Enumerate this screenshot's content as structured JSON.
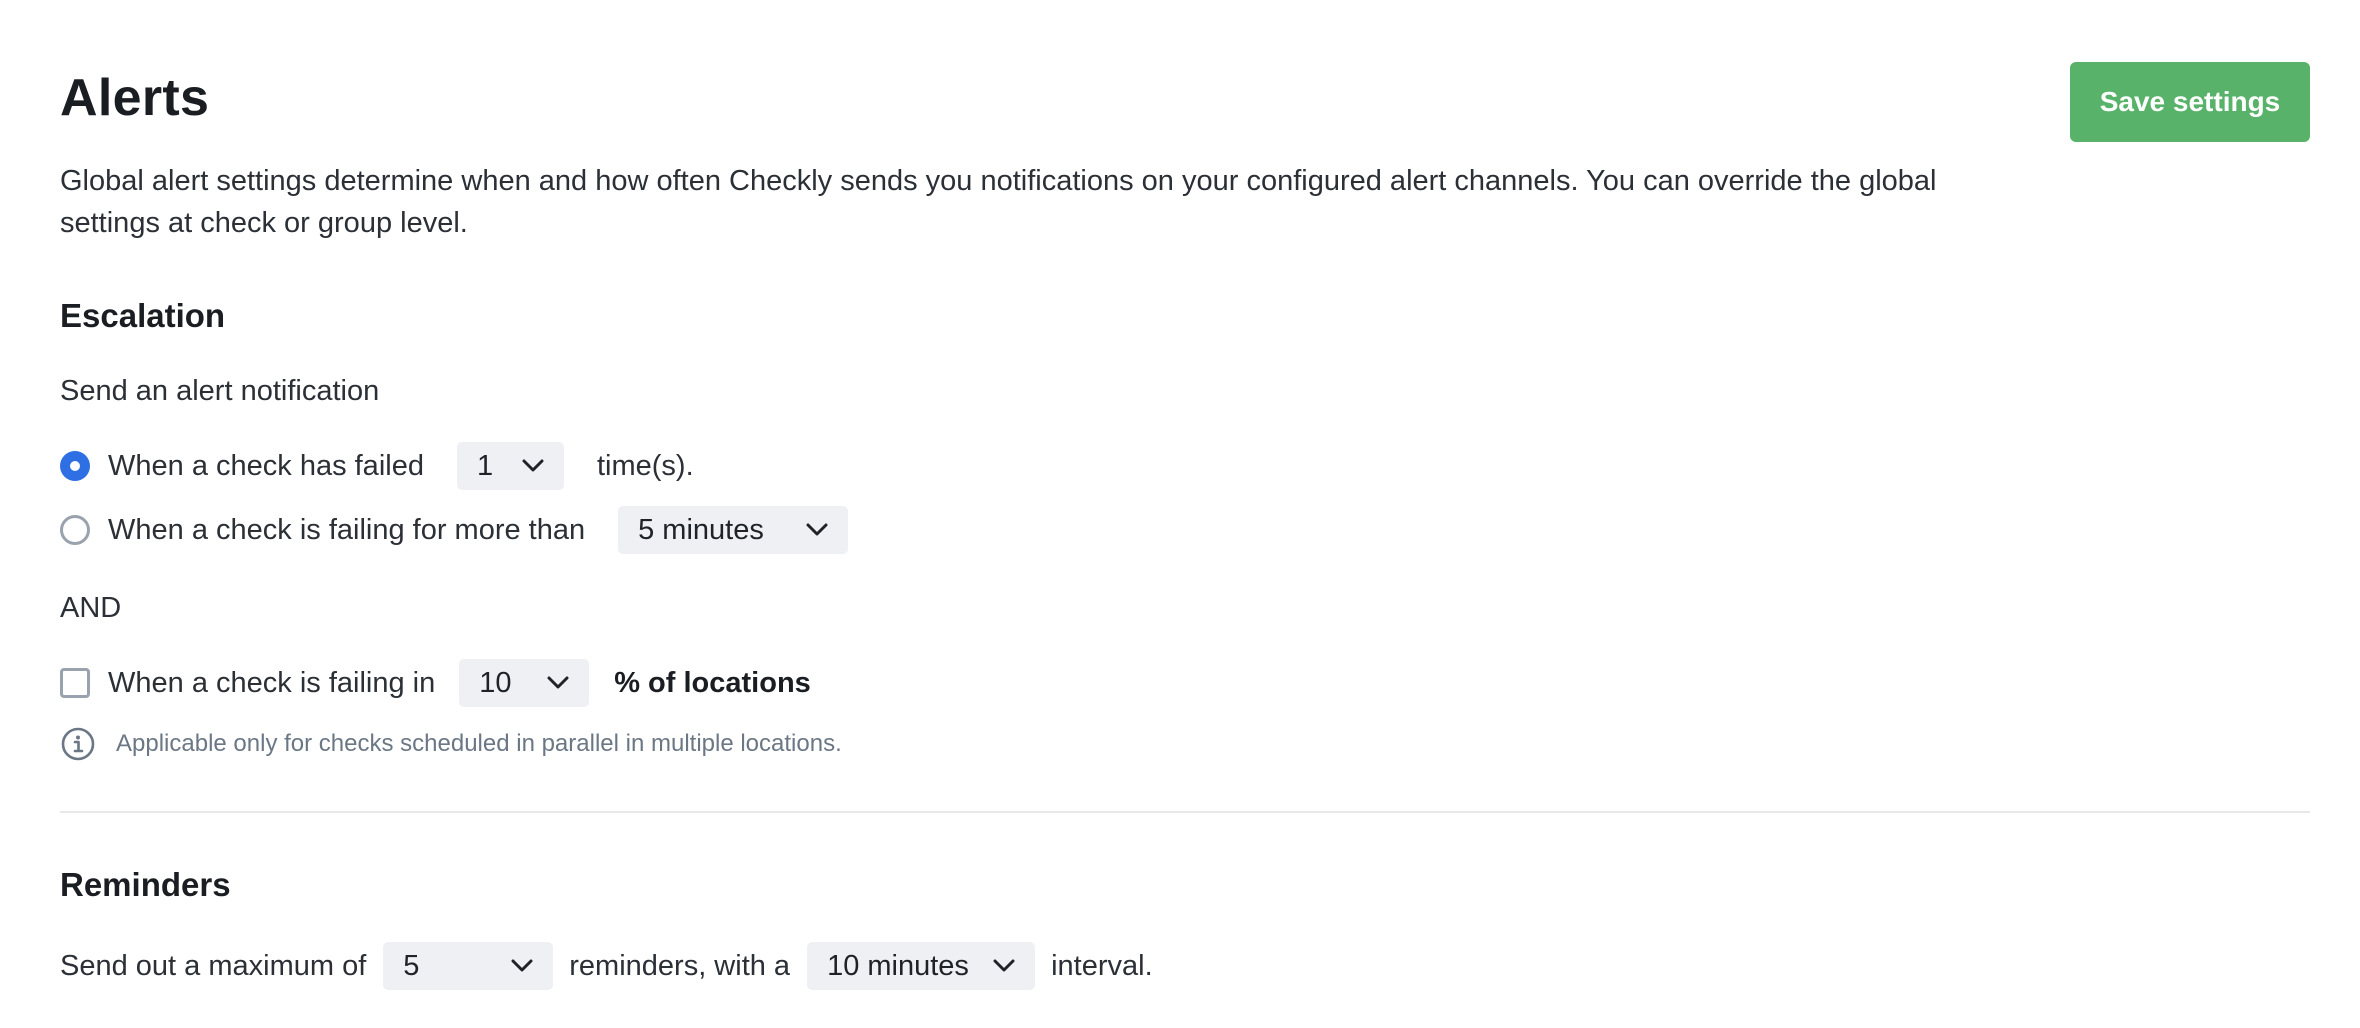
{
  "header": {
    "title": "Alerts",
    "save_label": "Save settings"
  },
  "description": "Global alert settings determine when and how often Checkly sends you notifications on your configured alert channels. You can override the global settings at check or group level.",
  "escalation": {
    "heading": "Escalation",
    "subheading": "Send an alert notification",
    "option_failed": {
      "label": "When a check has failed",
      "selected": true,
      "select_value": "1",
      "suffix": "time(s)."
    },
    "option_failing_for": {
      "label": "When a check is failing for more than",
      "selected": false,
      "select_value": "5 minutes"
    },
    "and_label": "AND",
    "locations": {
      "label": "When a check is failing in",
      "checked": false,
      "select_value": "10",
      "suffix": "% of locations"
    },
    "info_text": "Applicable only for checks scheduled in parallel in multiple locations."
  },
  "reminders": {
    "heading": "Reminders",
    "prefix": "Send out a maximum of",
    "count_value": "5",
    "middle": "reminders, with a",
    "interval_value": "10 minutes",
    "suffix": "interval."
  },
  "colors": {
    "accent": "#2f6fe4",
    "save_button": "#58b26a",
    "select_background": "#eef0f3",
    "muted_text": "#6b7785"
  },
  "icons": {
    "chevron": "chevron-down-icon",
    "info": "info-circle-icon"
  }
}
